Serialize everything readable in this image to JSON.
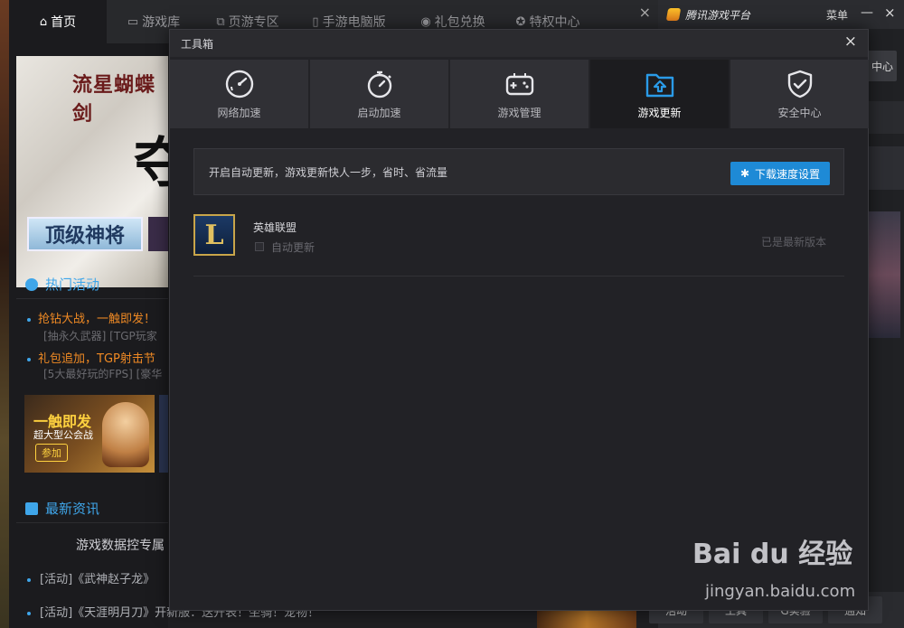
{
  "client": {
    "nav": [
      {
        "label": "首页",
        "icon": "home-icon",
        "active": true
      },
      {
        "label": "游戏库",
        "icon": "monitor-icon"
      },
      {
        "label": "页游专区",
        "icon": "windows-icon"
      },
      {
        "label": "手游电脑版",
        "icon": "phone-icon"
      },
      {
        "label": "礼包兑换",
        "icon": "gift-icon"
      },
      {
        "label": "特权中心",
        "icon": "medal-icon"
      }
    ],
    "close": "×",
    "banner": {
      "logo": "流星蝴蝶剑",
      "strip": "顶级神将"
    },
    "hot": {
      "title": "热门活动",
      "items": [
        {
          "main": "抢钻大战，一触即发！",
          "sub": "[抽永久武器]  [TGP玩家"
        },
        {
          "main": "礼包追加，TGP射击节",
          "sub": "[5大最好玩的FPS]  [豪华"
        }
      ],
      "promo": {
        "title": "一触即发",
        "sub": "超大型公会战",
        "btn": "参加"
      }
    },
    "news": {
      "title": "最新资讯",
      "feature": "游戏数据控专属",
      "items": [
        "[活动]《武神赵子龙》",
        "[活动]《天涯明月刀》开新服：送开表！坐骑！宠物！"
      ]
    }
  },
  "platform": {
    "name": "腾讯游戏平台",
    "menu": "菜单",
    "minimize": "—",
    "close": "×",
    "center_btn": "中心",
    "bottom": [
      "活动",
      "工具",
      "G实验",
      "通知"
    ]
  },
  "dialog": {
    "title": "工具箱",
    "close": "×",
    "tabs": [
      {
        "label": "网络加速",
        "icon": "speedometer-icon",
        "active": false
      },
      {
        "label": "启动加速",
        "icon": "stopwatch-icon",
        "active": false
      },
      {
        "label": "游戏管理",
        "icon": "gamepad-icon",
        "active": false
      },
      {
        "label": "游戏更新",
        "icon": "folder-upload-icon",
        "active": true
      },
      {
        "label": "安全中心",
        "icon": "shield-check-icon",
        "active": false
      }
    ],
    "info": "开启自动更新，游戏更新快人一步，省时、省流量",
    "download_button": "下载速度设置",
    "games": [
      {
        "name": "英雄联盟",
        "auto_update_label": "自动更新",
        "auto_update": false,
        "status": "已是最新版本",
        "icon_letter": "L"
      }
    ],
    "accent": "#1e8ad6"
  },
  "watermark": {
    "line1": "Bai du 经验",
    "line2": "jingyan.baidu.com"
  }
}
